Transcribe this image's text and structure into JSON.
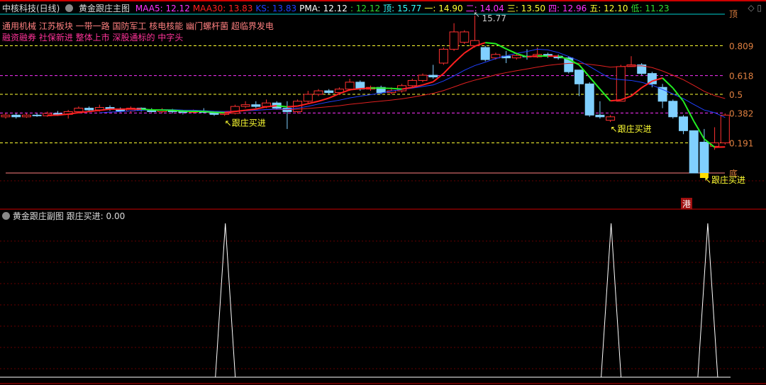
{
  "header": {
    "stock": "中核科技(日线)",
    "indicator": "黄金跟庄主图",
    "values": [
      {
        "label": "MAA5: 12.12",
        "color": "#ff33ff"
      },
      {
        "label": "MAA30: 13.83",
        "color": "#ff2020"
      },
      {
        "label": "KS: 13.83",
        "color": "#2040ff"
      },
      {
        "label": "PMA: 12.12",
        "color": "#ffffff"
      },
      {
        "label": ": 12.12",
        "color": "#33dd33"
      },
      {
        "label": "顶: 15.77",
        "color": "#33ffff"
      },
      {
        "label": "一: 14.90",
        "color": "#ffff33"
      },
      {
        "label": "二: 14.04",
        "color": "#ff33ff"
      },
      {
        "label": "三: 13.50",
        "color": "#ffff33"
      },
      {
        "label": "四: 12.96",
        "color": "#ff33ff"
      },
      {
        "label": "五: 12.10",
        "color": "#ffff33"
      },
      {
        "label": "低: 11.23",
        "color": "#33dd33"
      }
    ]
  },
  "tags_line1": "通用机械 江苏板块 一带一路 国防军工 核电核能 幽门螺杆菌 超临界发电",
  "tags_line2": "融资融券 社保新进 整体上市 深股通标的 中字头",
  "fib_levels": [
    {
      "label": "顶",
      "price": 15.77
    },
    {
      "label": "0.809",
      "price": 14.9
    },
    {
      "label": "0.618",
      "price": 14.04
    },
    {
      "label": "0.5",
      "price": 13.5
    },
    {
      "label": "0.382",
      "price": 12.96
    },
    {
      "label": "0.191",
      "price": 12.1
    },
    {
      "label": "底",
      "price": 11.23
    }
  ],
  "peak_label": "15.77",
  "buy_label": "跟庄买进",
  "badge": "港",
  "sub": {
    "title": "黄金跟庄副图",
    "value": "跟庄买进: 0.00"
  },
  "price_range": [
    11.23,
    15.77
  ],
  "candles": [
    [
      12.85,
      12.9,
      12.95,
      12.8
    ],
    [
      12.9,
      12.85,
      12.95,
      12.8
    ],
    [
      12.85,
      12.9,
      12.95,
      12.82
    ],
    [
      12.9,
      12.88,
      12.95,
      12.85
    ],
    [
      12.88,
      12.95,
      13.0,
      12.85
    ],
    [
      12.95,
      12.92,
      13.02,
      12.88
    ],
    [
      12.92,
      13.0,
      13.05,
      12.8
    ],
    [
      13.0,
      13.1,
      13.15,
      12.95
    ],
    [
      13.1,
      13.05,
      13.15,
      13.0
    ],
    [
      13.05,
      13.12,
      13.2,
      13.0
    ],
    [
      13.12,
      13.08,
      13.18,
      13.02
    ],
    [
      13.08,
      13.02,
      13.12,
      12.98
    ],
    [
      13.02,
      13.1,
      13.15,
      12.95
    ],
    [
      13.1,
      13.05,
      13.12,
      13.0
    ],
    [
      13.05,
      13.0,
      13.1,
      12.98
    ],
    [
      13.0,
      13.05,
      13.1,
      12.95
    ],
    [
      13.05,
      13.0,
      13.08,
      12.95
    ],
    [
      13.0,
      12.98,
      13.05,
      12.92
    ],
    [
      12.98,
      13.02,
      13.06,
      12.95
    ],
    [
      13.02,
      12.98,
      13.1,
      12.95
    ],
    [
      12.98,
      12.92,
      13.0,
      12.88
    ],
    [
      12.92,
      12.95,
      13.0,
      12.88
    ],
    [
      12.95,
      13.15,
      13.2,
      12.92
    ],
    [
      13.15,
      13.2,
      13.3,
      13.1
    ],
    [
      13.2,
      13.15,
      13.3,
      13.1
    ],
    [
      13.15,
      13.25,
      13.35,
      13.1
    ],
    [
      13.25,
      13.1,
      13.3,
      13.05
    ],
    [
      13.1,
      13.0,
      13.3,
      12.5
    ],
    [
      13.0,
      13.3,
      13.35,
      12.95
    ],
    [
      13.3,
      13.5,
      13.6,
      13.25
    ],
    [
      13.5,
      13.6,
      13.65,
      13.45
    ],
    [
      13.6,
      13.55,
      13.65,
      13.5
    ],
    [
      13.55,
      13.65,
      13.7,
      13.5
    ],
    [
      13.65,
      13.85,
      13.95,
      13.6
    ],
    [
      13.85,
      13.65,
      13.9,
      13.6
    ],
    [
      13.65,
      13.7,
      13.75,
      13.6
    ],
    [
      13.7,
      13.55,
      13.75,
      13.5
    ],
    [
      13.55,
      13.6,
      13.7,
      13.5
    ],
    [
      13.6,
      13.75,
      13.8,
      13.55
    ],
    [
      13.75,
      13.9,
      13.95,
      13.7
    ],
    [
      13.9,
      14.05,
      14.1,
      13.85
    ],
    [
      14.05,
      14.0,
      14.35,
      13.95
    ],
    [
      14.4,
      14.8,
      14.85,
      14.35
    ],
    [
      14.8,
      15.3,
      15.55,
      14.75
    ],
    [
      15.0,
      15.3,
      15.35,
      14.95
    ],
    [
      14.9,
      15.05,
      15.77,
      14.85
    ],
    [
      14.85,
      14.5,
      14.9,
      14.45
    ],
    [
      14.55,
      14.65,
      14.7,
      14.5
    ],
    [
      14.6,
      14.55,
      14.75,
      14.4
    ],
    [
      14.55,
      14.62,
      14.7,
      14.5
    ],
    [
      14.6,
      14.58,
      14.8,
      14.5
    ],
    [
      14.58,
      14.65,
      14.85,
      14.55
    ],
    [
      14.65,
      14.6,
      14.7,
      14.55
    ],
    [
      14.6,
      14.55,
      14.65,
      14.5
    ],
    [
      14.55,
      14.15,
      14.6,
      14.1
    ],
    [
      14.2,
      13.8,
      14.2,
      13.45
    ],
    [
      13.8,
      12.9,
      13.85,
      12.85
    ],
    [
      12.9,
      12.85,
      13.3,
      12.8
    ],
    [
      12.75,
      12.85,
      12.9,
      12.7
    ],
    [
      13.3,
      14.3,
      14.35,
      13.3
    ],
    [
      14.3,
      14.35,
      14.6,
      14.3
    ],
    [
      14.35,
      14.1,
      14.4,
      14.05
    ],
    [
      14.1,
      13.8,
      14.15,
      13.7
    ],
    [
      13.7,
      13.3,
      13.8,
      13.1
    ],
    [
      13.3,
      12.85,
      13.35,
      12.8
    ],
    [
      12.85,
      12.45,
      12.9,
      12.35
    ],
    [
      12.45,
      11.23,
      12.45,
      11.23
    ],
    [
      12.12,
      11.23,
      12.5,
      11.23
    ],
    [
      12.0,
      12.1,
      12.55,
      11.9
    ],
    [
      12.1,
      12.9,
      12.95,
      12.05
    ]
  ],
  "signals": [
    21,
    58,
    67
  ]
}
